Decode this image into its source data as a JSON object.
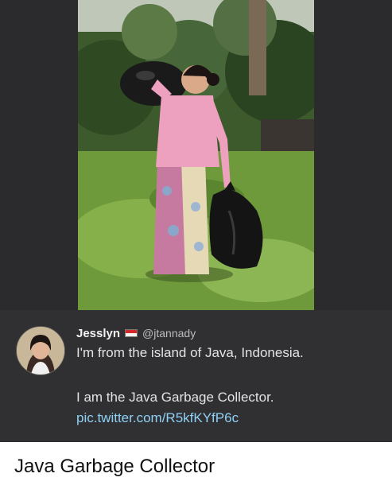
{
  "tweet": {
    "display_name": "Jesslyn",
    "handle": "@jtannady",
    "line1": "I'm from the island of Java, Indonesia.",
    "line2": "I am the Java Garbage Collector.",
    "link": "pic.twitter.com/R5kfKYfP6c",
    "flag_icon": "indonesia-flag-icon"
  },
  "caption": "Java Garbage Collector",
  "colors": {
    "panel_background": "#2b2b2d",
    "tweet_background": "#303033",
    "link": "#8fd0f5"
  }
}
